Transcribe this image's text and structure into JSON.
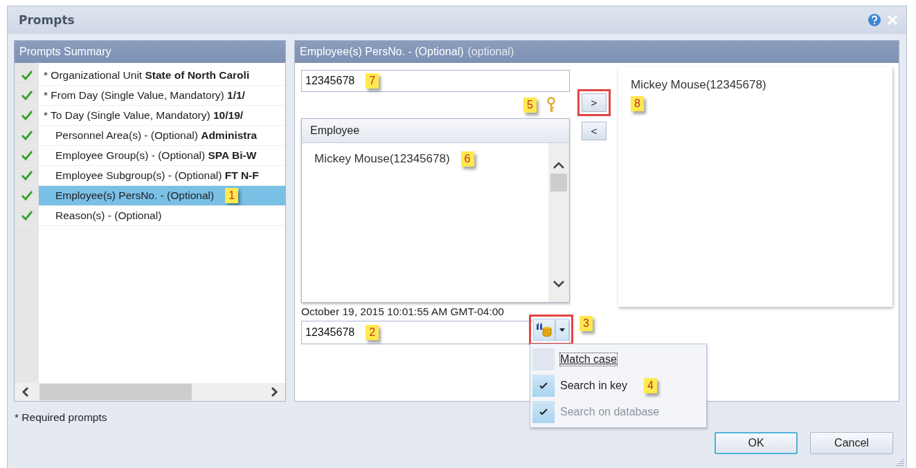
{
  "window": {
    "title": "Prompts"
  },
  "summary": {
    "title": "Prompts Summary",
    "items": [
      {
        "label": "* Organizational Unit",
        "value": "State of North Caroli",
        "required": true,
        "valid": true,
        "selected": false
      },
      {
        "label": "* From Day (Single Value, Mandatory)",
        "value": "1/1/",
        "required": true,
        "valid": true,
        "selected": false
      },
      {
        "label": "* To Day (Single Value, Mandatory)",
        "value": "10/19/",
        "required": true,
        "valid": true,
        "selected": false
      },
      {
        "label": "Personnel Area(s) - (Optional)",
        "value": "Administra",
        "required": false,
        "valid": true,
        "selected": false
      },
      {
        "label": "Employee Group(s) - (Optional)",
        "value": "SPA Bi-W",
        "required": false,
        "valid": true,
        "selected": false
      },
      {
        "label": "Employee Subgroup(s) - (Optional)",
        "value": "FT N-F",
        "required": false,
        "valid": true,
        "selected": false
      },
      {
        "label": "Employee(s) PersNo. - (Optional)",
        "required": false,
        "valid": true,
        "selected": true,
        "callout": "1"
      },
      {
        "label": "Reason(s) - (Optional)",
        "required": false,
        "valid": true,
        "selected": false
      }
    ],
    "note": "* Required prompts"
  },
  "prompt": {
    "title": "Employee(s) PersNo. - (Optional)",
    "hint": "(optional)",
    "filter": {
      "value": "12345678",
      "callout": "7"
    },
    "key_callout": "5",
    "list": {
      "header": "Employee",
      "items": [
        {
          "text": "Mickey Mouse(12345678)",
          "callout": "6"
        }
      ]
    },
    "add_button": {
      "label": ">",
      "highlighted": true
    },
    "remove_button": {
      "label": "<",
      "highlighted": false
    },
    "selected_values": [
      {
        "text": "Mickey Mouse(12345678)",
        "callout": "8"
      }
    ],
    "timestamp": "October 19, 2015 10:01:55 AM GMT-04:00",
    "search": {
      "value": "12345678",
      "callout": "2",
      "button_highlighted": true,
      "button_callout": "3"
    },
    "search_options": [
      {
        "label": "Match case",
        "checked": false,
        "disabled": false,
        "focused": true
      },
      {
        "label": "Search in key",
        "checked": true,
        "disabled": false,
        "focused": false,
        "callout": "4"
      },
      {
        "label": "Search on database",
        "checked": true,
        "disabled": true,
        "focused": false
      }
    ]
  },
  "buttons": [
    {
      "label": "OK",
      "default": true
    },
    {
      "label": "Cancel",
      "default": false
    }
  ]
}
